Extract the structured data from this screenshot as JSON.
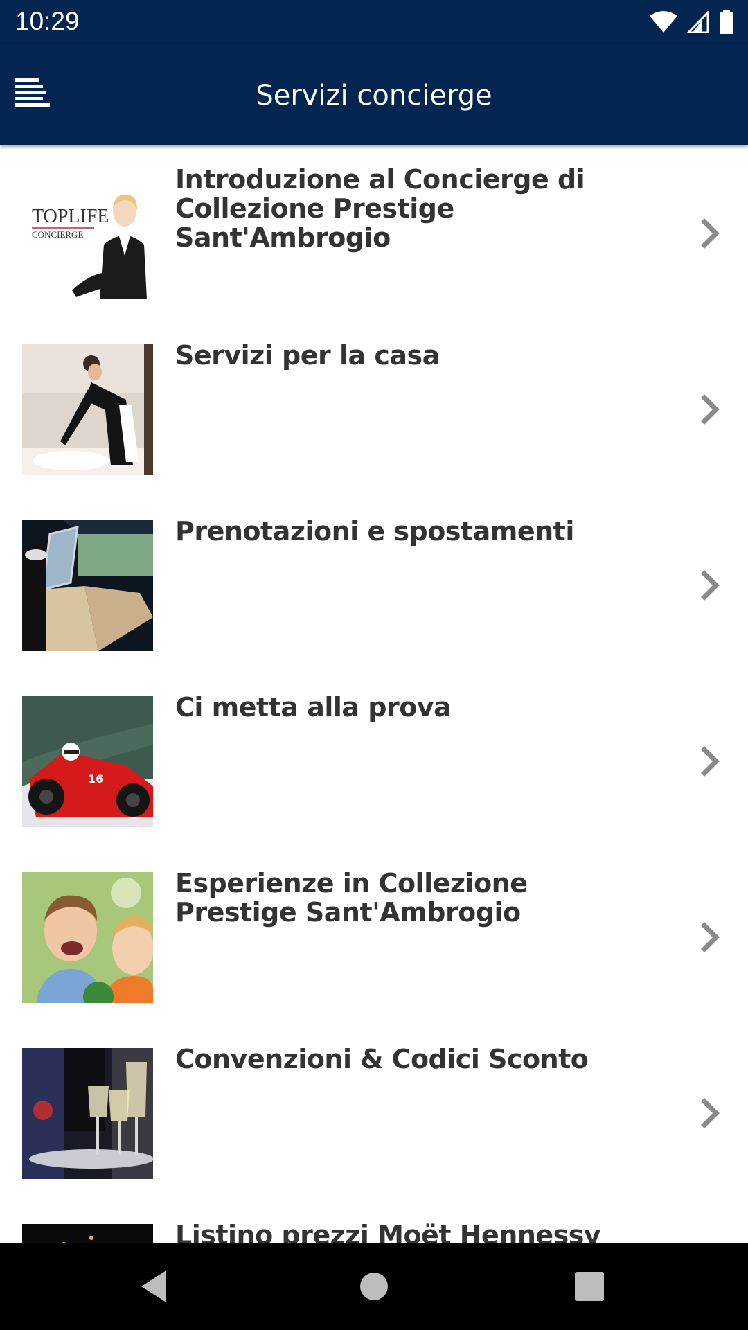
{
  "status_bar": {
    "time": "10:29"
  },
  "app_bar": {
    "title": "Servizi concierge",
    "menu_icon": "menu-lines-icon"
  },
  "items": [
    {
      "title": "Introduzione al Concierge di Collezione Prestige Sant'Ambrogio",
      "thumbnail_text_1": "TOPLIFE",
      "thumbnail_text_2": "CONCIERGE"
    },
    {
      "title": "Servizi per la casa"
    },
    {
      "title": "Prenotazioni e spostamenti"
    },
    {
      "title": "Ci metta alla prova"
    },
    {
      "title": "Esperienze in Collezione Prestige Sant'Ambrogio"
    },
    {
      "title": "Convenzioni & Codici Sconto"
    },
    {
      "title": "Listino prezzi Moët Hennessy"
    }
  ],
  "colors": {
    "primary": "#03254f",
    "title_text": "#333333",
    "chevron": "#8a8a8a"
  }
}
